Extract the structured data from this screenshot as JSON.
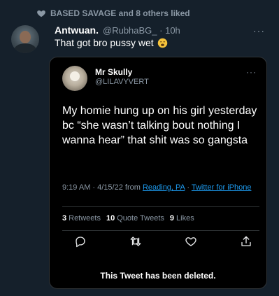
{
  "liked_by": {
    "text": "BASED SAVAGE and 8 others liked"
  },
  "reply_tweet": {
    "name": "Antwuan.",
    "handle": "@RubhaBG_",
    "time": "· 10h",
    "text": "That got bro pussy wet",
    "more": "···"
  },
  "quoted_tweet": {
    "name": "Mr Skully",
    "handle": "@LILAVYVERT",
    "more": "···",
    "text": "My homie hung up on his girl yesterday bc “she wasn’t talking bout nothing I wanna hear” that shit was so gangsta",
    "time": "9:19 AM · 4/15/22 from ",
    "location": "Reading, PA",
    "sep": " · ",
    "client": "Twitter for iPhone",
    "stats": {
      "retweets_count": "3",
      "retweets_label": "Retweets",
      "quotes_count": "10",
      "quotes_label": "Quote Tweets",
      "likes_count": "9",
      "likes_label": "Likes"
    },
    "deleted_notice": "This Tweet has been deleted."
  },
  "icons": {
    "liked": "heart-icon",
    "emoji": "weary-face-emoji",
    "reply": "reply-icon",
    "retweet": "retweet-icon",
    "like": "like-icon",
    "share": "share-icon"
  },
  "colors": {
    "background": "#15202b",
    "card": "#000000",
    "link": "#1d9bf0",
    "muted": "#8b98a5"
  }
}
